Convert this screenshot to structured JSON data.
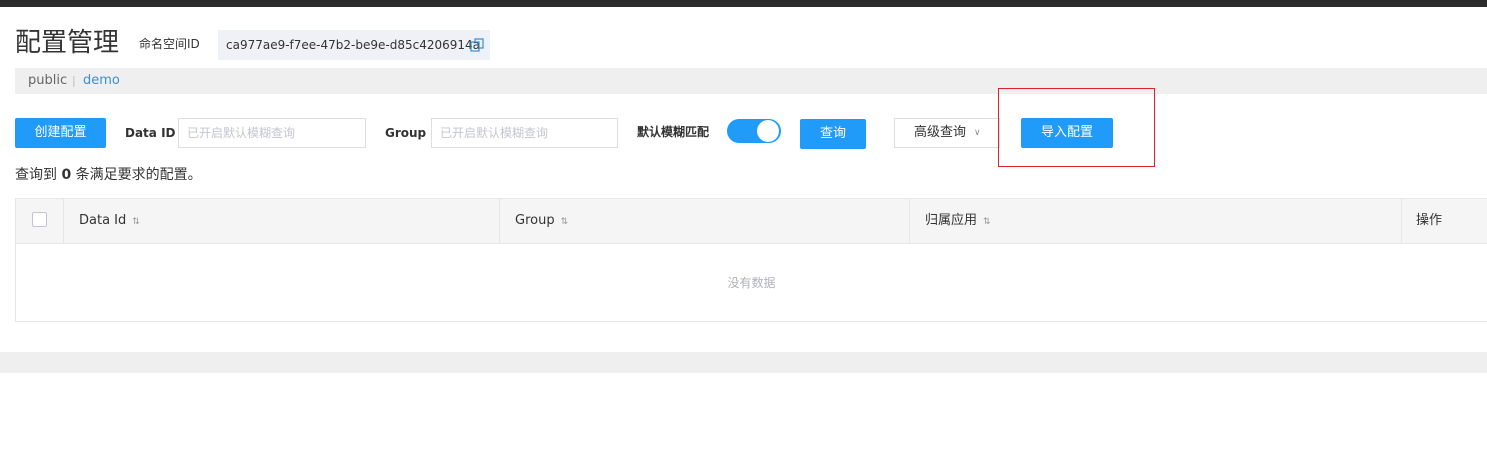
{
  "header": {
    "title": "配置管理",
    "namespace_label": "命名空间ID",
    "namespace_id": "ca977ae9-f7ee-47b2-be9e-d85c4206914a"
  },
  "namespaces": [
    {
      "label": "public"
    },
    {
      "label": "demo"
    }
  ],
  "namespace_separator": "|",
  "toolbar": {
    "create_label": "创建配置",
    "dataid_label": "Data ID",
    "dataid_placeholder": "已开启默认模糊查询",
    "group_label": "Group",
    "group_placeholder": "已开启默认模糊查询",
    "fuzzy_label": "默认模糊匹配",
    "fuzzy_enabled": true,
    "query_label": "查询",
    "advanced_label": "高级查询",
    "import_label": "导入配置"
  },
  "result": {
    "prefix": "查询到",
    "count": "0",
    "suffix": "条满足要求的配置。"
  },
  "table": {
    "columns": [
      "Data Id",
      "Group",
      "归属应用",
      "操作"
    ],
    "empty_text": "没有数据"
  },
  "colors": {
    "primary": "#209bfa",
    "highlight": "#e0202b",
    "link": "#3b8ed0"
  }
}
